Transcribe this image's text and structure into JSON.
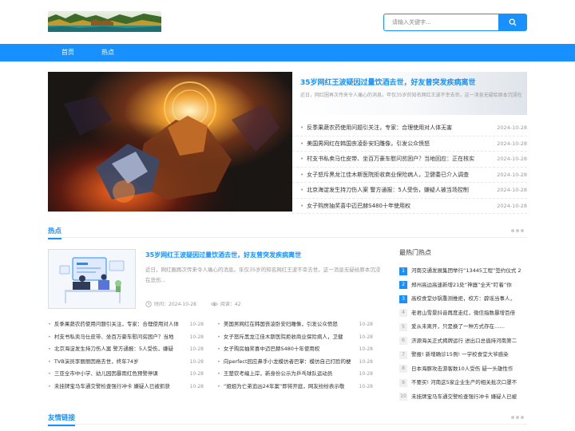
{
  "search": {
    "placeholder": "请输入关键字..."
  },
  "nav": {
    "items": [
      "首页",
      "热点"
    ]
  },
  "featured": {
    "title": "35岁网红王波疑因过量饮酒去世，好友曾突发疾病离世",
    "desc": "近日，网红圈再次传来令人痛心的消息。年仅35岁的知名网红王波不幸去世。这一消息无疑给原本沉浸在悲伤..."
  },
  "top_news": [
    {
      "title": "反季果蔬农药使用问题引关注，专家：合理使用对人体无害",
      "date": "2024-10-28"
    },
    {
      "title": "美国男网红在韩国丧凌卧安妇雕像，引发公众愤怒",
      "date": "2024-10-28"
    },
    {
      "title": "村支书私卖马仕皮带、坐百万豪车慰问贫困户？当地回应：正在核实",
      "date": "2024-10-28"
    },
    {
      "title": "女子怒斥黑龙江佳木斯医院拒收商业保险病人，卫健委已介入调查",
      "date": "2024-10-28"
    },
    {
      "title": "北京海淀发生持刀伤人案 警方通报：5人受伤，嫌疑人被当场控制",
      "date": "2024-10-28"
    },
    {
      "title": "女子购房抽奖喜中迈巴赫S480十年使用权",
      "date": "2024-10-28"
    }
  ],
  "hot": {
    "section_title": "热点",
    "article": {
      "title": "35岁网红王波疑因过量饮酒去世，好友曾突发疾病离世",
      "desc": "近日，网红圈再次传来令人痛心的消息。年仅35岁的知名网红王波不幸去世。这一消息无疑给原本沉浸在悲伤...",
      "time": "时间：2024-10-28",
      "reads": "阅读：42"
    },
    "list_left": [
      {
        "title": "反季果蔬农药使用问题引关注，专家：合理使用对人体",
        "date": "10-28"
      },
      {
        "title": "村支书私卖马仕皮带、坐百万豪车慰问贫困户？当地",
        "date": "10-28"
      },
      {
        "title": "北京海淀发生持刀伤人案 警方通报：5人受伤，嫌疑",
        "date": "10-28"
      },
      {
        "title": "TVB演员李丽丽因癌去世，终年74岁",
        "date": "10-28"
      },
      {
        "title": "三亚全市中小学、幼儿园因暴雨红色预警停课",
        "date": "10-28"
      },
      {
        "title": "未挂牌宝马车通交警检查强行冲卡 嫌疑人已被抓获",
        "date": "10-28"
      }
    ],
    "list_right": [
      {
        "title": "美国男网红在韩国丧凌卧安妇雕像，引发公众愤怒",
        "date": "10-28"
      },
      {
        "title": "女子怒斥黑龙江佳木斯医院拒收商业保险病人，卫健",
        "date": "10-28"
      },
      {
        "title": "女子购房抽奖喜中迈巴赫S480十年使用权",
        "date": "10-28"
      },
      {
        "title": "向perfect回应鼻手小龙模仿者巴掌：模仿自己打脸的梗",
        "date": "10-28"
      },
      {
        "title": "王楚钦考编上岸，新身份公示为乒乓球队运动员",
        "date": "10-28"
      },
      {
        "title": "“姐姐为亡弟追凶24年案”即将开庭，网友纷纷表示敬",
        "date": "10-28"
      }
    ]
  },
  "sidebar": {
    "title": "最热门热点",
    "items": [
      {
        "num": "1",
        "title": "河南交通发展集团举行“13445工程”签约仪式 2"
      },
      {
        "num": "2",
        "title": "郑州高边高速新增21处“神器”全天“盯着”你"
      },
      {
        "num": "3",
        "title": "高校食堂炒锅重测推拒，校方：辟谣当事人，"
      },
      {
        "num": "4",
        "title": "老君山雪景抖音再度走红，微信指数暴增百倍"
      },
      {
        "num": "5",
        "title": "爱从未离开，只是换了一种方式存在……"
      },
      {
        "num": "6",
        "title": "济源海关正式揭牌运行 进出口总值持河南第二"
      },
      {
        "num": "7",
        "title": "警报! 新增确诊15例! 一学校食堂大爷感染"
      },
      {
        "num": "8",
        "title": "日本海豚攻击游客数10人受伤 疑一头雄性作"
      },
      {
        "num": "9",
        "title": "不要买! 河南这5家企业生产的相关批次口罩不"
      },
      {
        "num": "10",
        "title": "未挂牌宝马车通交警检查强行冲卡 嫌疑人已被"
      }
    ]
  },
  "links": {
    "section_title": "友情链接"
  },
  "colors": {
    "accent": "#1890ff",
    "muted": "#999999"
  }
}
